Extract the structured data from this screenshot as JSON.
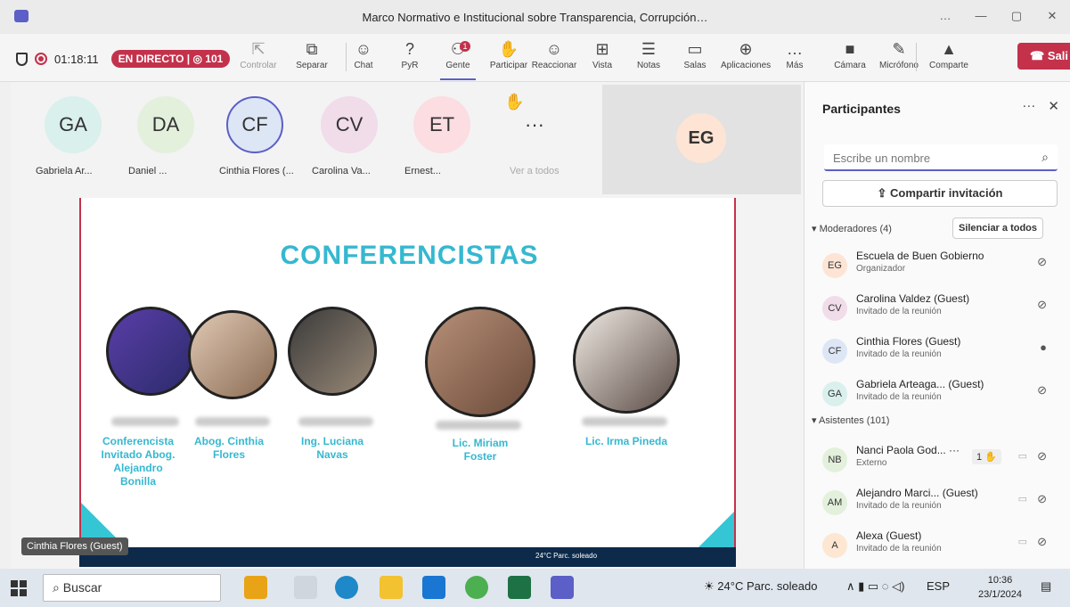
{
  "window": {
    "title": "Marco Normativo e Institucional sobre Transparencia, Corrupción…",
    "controls": [
      "…",
      "—",
      "▢",
      "✕"
    ]
  },
  "toolbar": {
    "timer": "01:18:11",
    "live_label": "EN DIRECTO",
    "live_count": "101",
    "items": [
      {
        "label": "Controlar",
        "icon": "⇱",
        "dim": true
      },
      {
        "label": "Separar",
        "icon": "⧉"
      },
      {
        "label": "Chat",
        "icon": "☺"
      },
      {
        "label": "PyR",
        "icon": "?"
      },
      {
        "label": "Gente",
        "icon": "⚇",
        "active": true,
        "badge": "1"
      },
      {
        "label": "Participar",
        "icon": "✋"
      },
      {
        "label": "Reaccionar",
        "icon": "☺"
      },
      {
        "label": "Vista",
        "icon": "⊞"
      },
      {
        "label": "Notas",
        "icon": "☰"
      },
      {
        "label": "Salas",
        "icon": "▭"
      },
      {
        "label": "Aplicaciones",
        "icon": "⊕"
      },
      {
        "label": "Más",
        "icon": "…"
      },
      {
        "label": "Cámara",
        "icon": "■"
      },
      {
        "label": "Micrófono",
        "icon": "✎"
      },
      {
        "label": "Comparte",
        "icon": "▲"
      }
    ],
    "leave_label": "Sali"
  },
  "strip": [
    {
      "initials": "GA",
      "name": "Gabriela Ar...",
      "color": "#d9f0ec"
    },
    {
      "initials": "DA",
      "name": "Daniel ...",
      "color": "#e3f0dc"
    },
    {
      "initials": "CF",
      "name": "Cinthia Flores (...",
      "color": "#dde6f5"
    },
    {
      "initials": "CV",
      "name": "Carolina Va...",
      "color": "#f1dcea"
    },
    {
      "initials": "ET",
      "name": "Ernest...",
      "color": "#fbdde2"
    },
    {
      "initials": "···",
      "name": "Ver a todos",
      "color": "#f3f3f3"
    }
  ],
  "active_tile": {
    "initials": "EG"
  },
  "slide": {
    "title": "CONFERENCISTAS",
    "speakers": [
      "Conferencista Invitado Abog. Alejandro Bonilla",
      "Abog. Cinthia Flores",
      "Ing. Luciana Navas",
      "Lic. Miriam Foster",
      "Lic. Irma Pineda"
    ],
    "taskbar_text": "24°C Parc. soleado"
  },
  "name_tag": "Cinthia Flores (Guest)",
  "panel": {
    "title": "Participantes",
    "search_placeholder": "Escribe un nombre",
    "invite_label": "Compartir invitación",
    "moderators_label": "Moderadores (4)",
    "mute_all_label": "Silenciar a todos",
    "attendees_label": "Asistentes (101)",
    "moderators": [
      {
        "initials": "EG",
        "name": "Escuela de Buen Gobierno",
        "role": "Organizador",
        "color": "#fde4d4"
      },
      {
        "initials": "CV",
        "name": "Carolina Valdez (Guest)",
        "role": "Invitado de la reunión",
        "color": "#f1dcea"
      },
      {
        "initials": "CF",
        "name": "Cinthia Flores (Guest)",
        "role": "Invitado de la reunión",
        "color": "#dde6f5"
      },
      {
        "initials": "GA",
        "name": "Gabriela Arteaga... (Guest)",
        "role": "Invitado de la reunión",
        "color": "#d9f0ec"
      }
    ],
    "attendees": [
      {
        "initials": "NB",
        "name": "Nanci Paola God... ···",
        "role": "Externo",
        "color": "#e3f0dc",
        "hand": "1 ✋"
      },
      {
        "initials": "AM",
        "name": "Alejandro Marci... (Guest)",
        "role": "Invitado de la reunión",
        "color": "#e3f0dc"
      },
      {
        "initials": "A",
        "name": "Alexa (Guest)",
        "role": "Invitado de la reunión",
        "color": "#fde7d2"
      }
    ]
  },
  "taskbar": {
    "search": "Buscar",
    "weather": "24°C Parc. soleado",
    "lang": "ESP",
    "time": "10:36",
    "date": "23/1/2024"
  }
}
